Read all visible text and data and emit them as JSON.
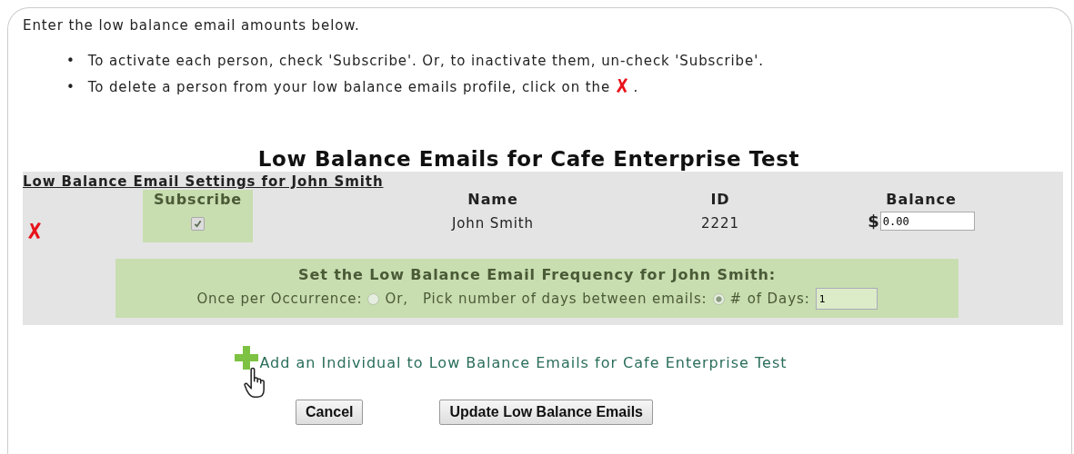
{
  "intro": "Enter the low balance email amounts below.",
  "bullets": [
    {
      "marker": "•",
      "text": "To activate each person, check 'Subscribe'. Or, to inactivate them, un-check 'Subscribe'."
    },
    {
      "marker": "•",
      "text": "To delete a person from your low balance emails profile, click on the",
      "after": "."
    }
  ],
  "title": "Low Balance Emails for Cafe Enterprise Test",
  "settings": {
    "heading": "Low Balance Email Settings for John Smith",
    "columns": [
      "Subscribe",
      "Name",
      "ID",
      "Balance"
    ],
    "person": {
      "subscribed": true,
      "name": "John Smith",
      "id": "2221",
      "currency": "$",
      "balance": "0.00"
    },
    "frequency": {
      "heading": "Set the Low Balance Email Frequency for John Smith:",
      "once_label": "Once per Occurrence:",
      "once_selected": false,
      "or": "Or,",
      "pick_label": "Pick number of days between emails:",
      "pick_selected": true,
      "days_label": "# of Days:",
      "days": "1"
    }
  },
  "add_link": "Add an Individual to Low Balance Emails for Cafe Enterprise Test",
  "buttons": [
    "Cancel",
    "Update Low Balance Emails"
  ]
}
